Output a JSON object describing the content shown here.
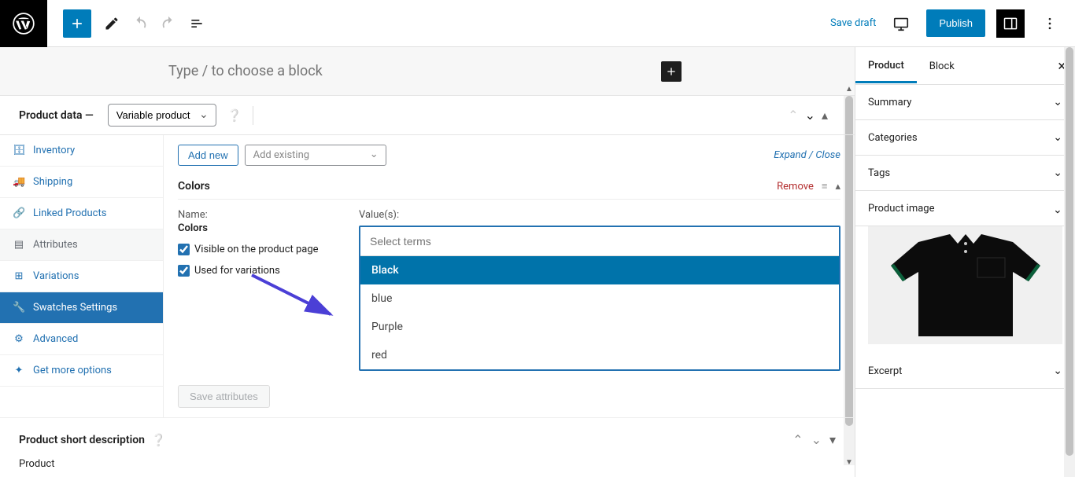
{
  "topbar": {
    "save_draft": "Save draft",
    "publish": "Publish"
  },
  "block_placeholder": "Type / to choose a block",
  "product_data": {
    "label": "Product data —",
    "type_selected": "Variable product",
    "tabs": {
      "inventory": "Inventory",
      "shipping": "Shipping",
      "linked": "Linked Products",
      "attributes": "Attributes",
      "variations": "Variations",
      "swatches": "Swatches Settings",
      "advanced": "Advanced",
      "more": "Get more options"
    },
    "add_new": "Add new",
    "add_existing_placeholder": "Add existing",
    "expand_close": "Expand / Close",
    "attribute": {
      "title": "Colors",
      "remove": "Remove",
      "name_label": "Name:",
      "name_value": "Colors",
      "visible_label": "Visible on the product page",
      "used_label": "Used for variations",
      "values_label": "Value(s):",
      "select_placeholder": "Select terms",
      "options": [
        "Black",
        "blue",
        "Purple",
        "red"
      ]
    },
    "save_attributes": "Save attributes"
  },
  "short_description": {
    "title": "Product short description",
    "product_word": "Product"
  },
  "sidebar": {
    "tabs": {
      "product": "Product",
      "block": "Block"
    },
    "panels": {
      "summary": "Summary",
      "categories": "Categories",
      "tags": "Tags",
      "product_image": "Product image",
      "excerpt": "Excerpt"
    }
  }
}
